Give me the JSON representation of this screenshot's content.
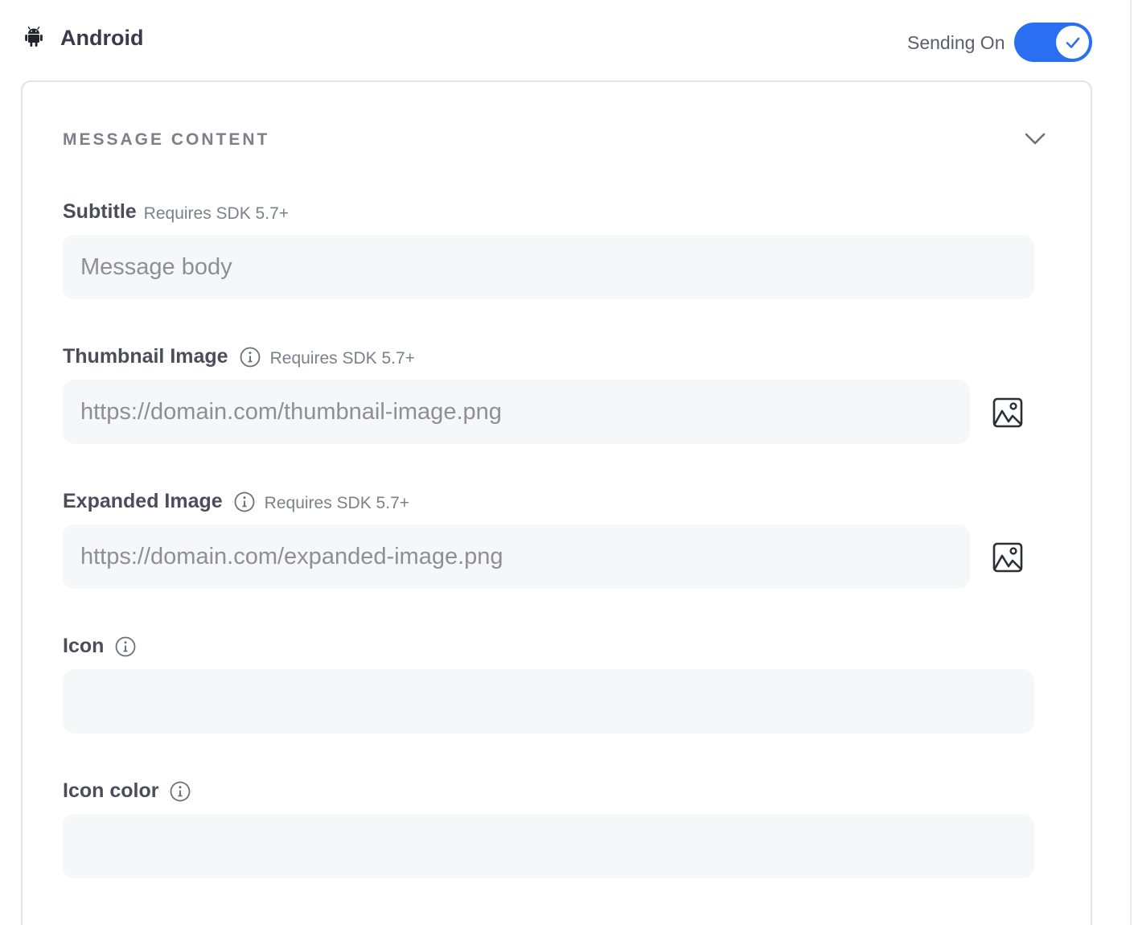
{
  "header": {
    "platform_title": "Android",
    "sending_label": "Sending On",
    "toggle_on": true,
    "accent_color": "#2a6ef2"
  },
  "section": {
    "title": "MESSAGE CONTENT"
  },
  "fields": {
    "subtitle": {
      "label": "Subtitle",
      "requirement": "Requires SDK 5.7+",
      "placeholder": "Message body",
      "value": ""
    },
    "thumbnail": {
      "label": "Thumbnail Image",
      "requirement": "Requires SDK 5.7+",
      "placeholder": "https://domain.com/thumbnail-image.png",
      "value": ""
    },
    "expanded": {
      "label": "Expanded Image",
      "requirement": "Requires SDK 5.7+",
      "placeholder": "https://domain.com/expanded-image.png",
      "value": ""
    },
    "icon": {
      "label": "Icon",
      "placeholder": "",
      "value": ""
    },
    "icon_color": {
      "label": "Icon color",
      "placeholder": "",
      "value": ""
    }
  },
  "icons": {
    "platform": "android-icon",
    "toggle_check": "check-icon",
    "collapse": "chevron-down-icon",
    "info": "info-icon",
    "image_picker": "image-icon"
  }
}
